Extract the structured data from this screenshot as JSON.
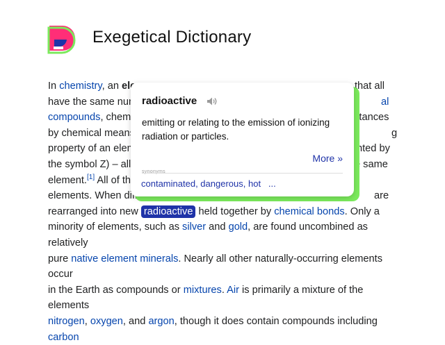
{
  "app": {
    "title": "Exegetical Dictionary"
  },
  "article": {
    "l1": {
      "t1": "In ",
      "a1": "chemistry",
      "t2": ", an ",
      "b1": "ele",
      "t3": "that all"
    },
    "l2": {
      "t1": "have the same num",
      "a1": "al"
    },
    "l3": {
      "a1": "compounds",
      "t1": ", chemic",
      "t2": "bstances"
    },
    "l4": {
      "t1": "by chemical means",
      "t2": "g"
    },
    "l5": {
      "t1": "property of an elem",
      "t2": "nted by"
    },
    "l6": {
      "t1": "the symbol Z) – all",
      "t2": "e same"
    },
    "l7": {
      "t1": "element.",
      "sup": "[1]",
      "t2": " All of the"
    },
    "l8": {
      "t1": "elements. When diffe",
      "t2": "are"
    },
    "l9": {
      "t1": "rearranged into new ",
      "hl": "radioactive",
      "t2": " held together by ",
      "a1": "chemical bonds",
      "t3": ". Only a"
    },
    "l10": {
      "t1": "minority of elements, such as ",
      "a1": "silver",
      "t2": " and ",
      "a2": "gold",
      "t3": ", are found uncombined as relatively"
    },
    "l11": {
      "t1": "pure ",
      "a1": "native element minerals",
      "t2": ". Nearly all other naturally-occurring elements occur"
    },
    "l12": {
      "t1": "in the Earth as compounds or ",
      "a1": "mixtures",
      "t2": ". ",
      "a2": "Air",
      "t3": " is primarily a mixture of the elements"
    },
    "l13": {
      "a1": "nitrogen",
      "t1": ", ",
      "a2": "oxygen",
      "t2": ", and ",
      "a3": "argon",
      "t3": ", though it does contain compounds including ",
      "a4": "carbon"
    }
  },
  "popup": {
    "word": "radioactive",
    "definition": "emitting or relating to the emission of ionizing radiation or particles.",
    "more": "More »",
    "synonyms_label": "synonyms",
    "synonyms": [
      "contaminated",
      "dangerous",
      "hot"
    ],
    "synonyms_more": "..."
  },
  "colors": {
    "brand_pink": "#ff2e77",
    "brand_blue": "#1f33a8",
    "accent_green": "#7bea5c",
    "link": "#0645ad"
  }
}
